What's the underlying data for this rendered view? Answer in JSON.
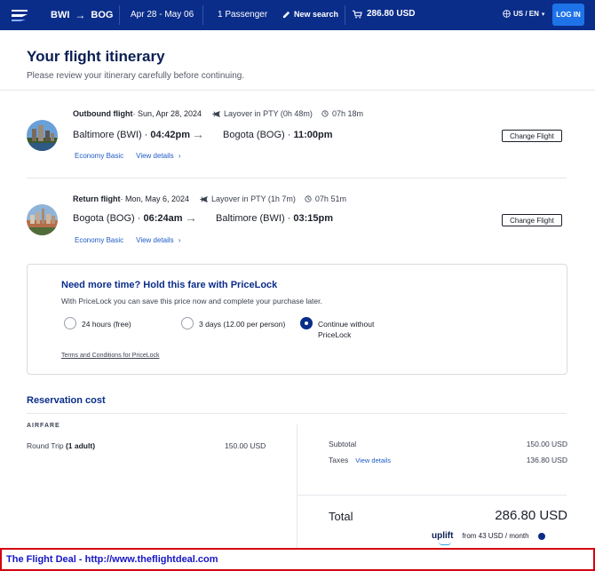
{
  "header": {
    "origin": "BWI",
    "destination": "BOG",
    "dates": "Apr 28 - May 06",
    "passengers": "1 Passenger",
    "new_search": "New search",
    "cart_total": "286.80 USD",
    "locale": "US / EN",
    "login": "LOG IN"
  },
  "page": {
    "title": "Your flight itinerary",
    "subtitle": "Please review your itinerary carefully before continuing."
  },
  "outbound": {
    "title": "Outbound flight",
    "date": " · Sun, Apr 28, 2024",
    "layover": "Layover in PTY (0h 48m)",
    "duration": "07h 18m",
    "from": "Baltimore (BWI)",
    "depart": "04:42pm",
    "to": "Bogota (BOG)",
    "arrive": "11:00pm",
    "fare": "Economy Basic",
    "details": "View details",
    "change": "Change Flight"
  },
  "return": {
    "title": "Return flight",
    "date": " · Mon, May 6, 2024",
    "layover": "Layover in PTY (1h 7m)",
    "duration": "07h 51m",
    "from": "Bogota (BOG)",
    "depart": "06:24am",
    "to": "Baltimore (BWI)",
    "arrive": "03:15pm",
    "fare": "Economy Basic",
    "details": "View details",
    "change": "Change Flight"
  },
  "pricelock": {
    "title": "Need more time? Hold this fare with PriceLock",
    "subtitle": "With PriceLock you can save this price now and complete your purchase later.",
    "options": [
      {
        "label": "24 hours (free)",
        "selected": false
      },
      {
        "label": "3 days (12.00 per person)",
        "selected": false
      },
      {
        "label_line1": "Continue without",
        "label_line2": "PriceLock",
        "selected": true
      }
    ],
    "terms": "Terms and Conditions for PriceLock"
  },
  "reservation": {
    "title": "Reservation cost",
    "airfare_heading": "AIRFARE",
    "round_trip_label": "Round Trip",
    "round_trip_pax": "(1 adult)",
    "round_trip_value": "150.00 USD",
    "subtotal_label": "Subtotal",
    "subtotal_value": "150.00 USD",
    "taxes_label": "Taxes",
    "taxes_link": "View details",
    "taxes_value": "136.80 USD",
    "total_label": "Total",
    "total_value": "286.80 USD",
    "uplift_brand": "uplift",
    "uplift_text": "from 43 USD  / month"
  },
  "banner": {
    "text": "The Flight Deal - http://www.theflightdeal.com"
  }
}
